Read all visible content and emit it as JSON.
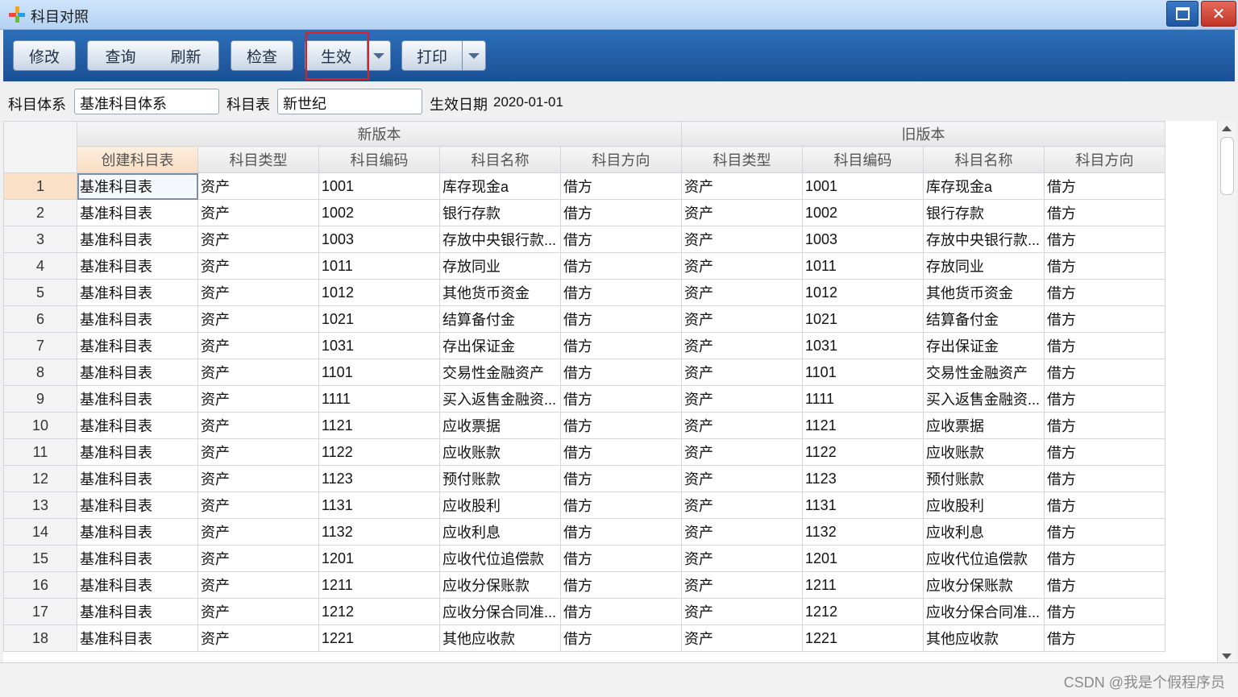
{
  "window": {
    "title": "科目对照",
    "maximize_icon": "maximize-icon",
    "close_symbol": "✕"
  },
  "toolbar": {
    "modify": "修改",
    "query": "查询",
    "refresh": "刷新",
    "check": "检查",
    "activate": "生效",
    "print": "打印"
  },
  "filter": {
    "system_label": "科目体系",
    "system_value": "基准科目体系",
    "table_label": "科目表",
    "table_value": "新世纪",
    "date_label": "生效日期",
    "date_value": "2020-01-01"
  },
  "grid": {
    "groups": {
      "new": "新版本",
      "old": "旧版本"
    },
    "columns": [
      "创建科目表",
      "科目类型",
      "科目编码",
      "科目名称",
      "科目方向",
      "科目类型",
      "科目编码",
      "科目名称",
      "科目方向"
    ],
    "rows": [
      [
        "1",
        "基准科目表",
        "资产",
        "1001",
        "库存现金a",
        "借方",
        "资产",
        "1001",
        "库存现金a",
        "借方"
      ],
      [
        "2",
        "基准科目表",
        "资产",
        "1002",
        "银行存款",
        "借方",
        "资产",
        "1002",
        "银行存款",
        "借方"
      ],
      [
        "3",
        "基准科目表",
        "资产",
        "1003",
        "存放中央银行款...",
        "借方",
        "资产",
        "1003",
        "存放中央银行款...",
        "借方"
      ],
      [
        "4",
        "基准科目表",
        "资产",
        "1011",
        "存放同业",
        "借方",
        "资产",
        "1011",
        "存放同业",
        "借方"
      ],
      [
        "5",
        "基准科目表",
        "资产",
        "1012",
        "其他货币资金",
        "借方",
        "资产",
        "1012",
        "其他货币资金",
        "借方"
      ],
      [
        "6",
        "基准科目表",
        "资产",
        "1021",
        "结算备付金",
        "借方",
        "资产",
        "1021",
        "结算备付金",
        "借方"
      ],
      [
        "7",
        "基准科目表",
        "资产",
        "1031",
        "存出保证金",
        "借方",
        "资产",
        "1031",
        "存出保证金",
        "借方"
      ],
      [
        "8",
        "基准科目表",
        "资产",
        "1101",
        "交易性金融资产",
        "借方",
        "资产",
        "1101",
        "交易性金融资产",
        "借方"
      ],
      [
        "9",
        "基准科目表",
        "资产",
        "1111",
        "买入返售金融资...",
        "借方",
        "资产",
        "1111",
        "买入返售金融资...",
        "借方"
      ],
      [
        "10",
        "基准科目表",
        "资产",
        "1121",
        "应收票据",
        "借方",
        "资产",
        "1121",
        "应收票据",
        "借方"
      ],
      [
        "11",
        "基准科目表",
        "资产",
        "1122",
        "应收账款",
        "借方",
        "资产",
        "1122",
        "应收账款",
        "借方"
      ],
      [
        "12",
        "基准科目表",
        "资产",
        "1123",
        "预付账款",
        "借方",
        "资产",
        "1123",
        "预付账款",
        "借方"
      ],
      [
        "13",
        "基准科目表",
        "资产",
        "1131",
        "应收股利",
        "借方",
        "资产",
        "1131",
        "应收股利",
        "借方"
      ],
      [
        "14",
        "基准科目表",
        "资产",
        "1132",
        "应收利息",
        "借方",
        "资产",
        "1132",
        "应收利息",
        "借方"
      ],
      [
        "15",
        "基准科目表",
        "资产",
        "1201",
        "应收代位追偿款",
        "借方",
        "资产",
        "1201",
        "应收代位追偿款",
        "借方"
      ],
      [
        "16",
        "基准科目表",
        "资产",
        "1211",
        "应收分保账款",
        "借方",
        "资产",
        "1211",
        "应收分保账款",
        "借方"
      ],
      [
        "17",
        "基准科目表",
        "资产",
        "1212",
        "应收分保合同准...",
        "借方",
        "资产",
        "1212",
        "应收分保合同准...",
        "借方"
      ],
      [
        "18",
        "基准科目表",
        "资产",
        "1221",
        "其他应收款",
        "借方",
        "资产",
        "1221",
        "其他应收款",
        "借方"
      ]
    ]
  },
  "status": {
    "watermark": "CSDN @我是个假程序员"
  },
  "colors": {
    "toolbar": "#1b4f94",
    "highlight": "#e02020",
    "selected": "#fbe0c8"
  }
}
